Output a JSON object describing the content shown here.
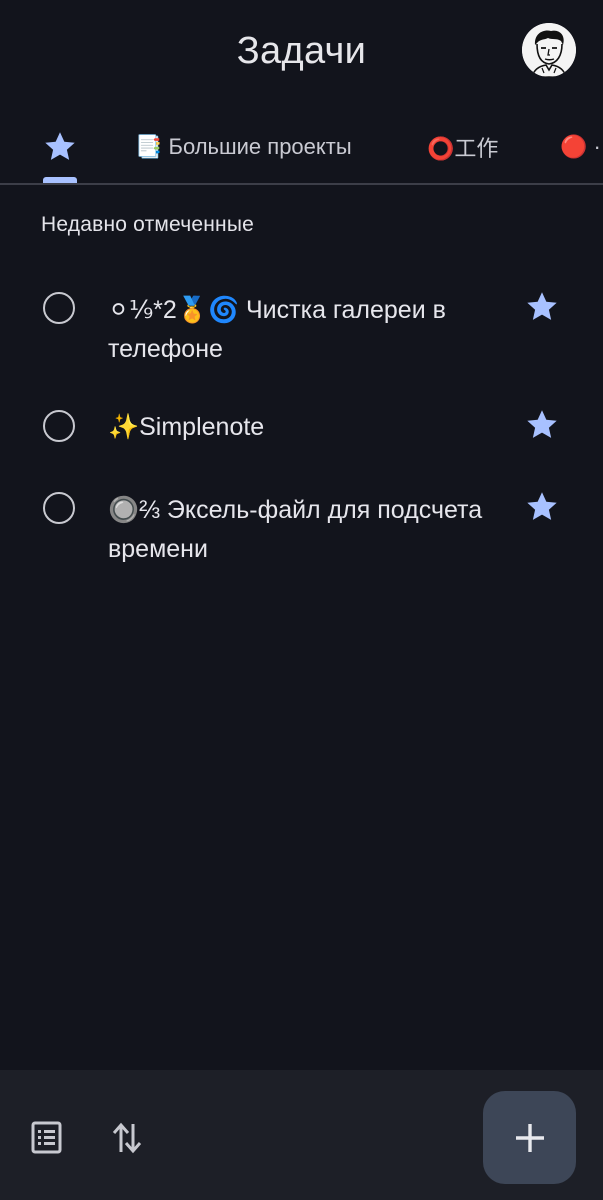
{
  "header": {
    "title": "Задачи"
  },
  "tabs": [
    {
      "label": "",
      "icon": "star-icon",
      "active": true
    },
    {
      "label": "📑 Большие проекты"
    },
    {
      "label": "⭕工作"
    },
    {
      "label": "🔴 ·"
    }
  ],
  "section": {
    "title": "Недавно отмеченные"
  },
  "tasks": [
    {
      "text": "⚪⅑*2🏅🌀 Чистка галереи в телефоне",
      "starred": true
    },
    {
      "text": "✨Simplenote",
      "starred": true
    },
    {
      "text": "🔘⅔ Эксель-файл для подсчета времени",
      "starred": true
    }
  ],
  "bottom_bar": {
    "icons": [
      "list-icon",
      "sort-icon"
    ],
    "fab_icon": "plus-icon"
  },
  "colors": {
    "background": "#12141c",
    "accent": "#a8c1ff",
    "bottom_bar": "#1d1f27",
    "fab": "#3d4657"
  }
}
